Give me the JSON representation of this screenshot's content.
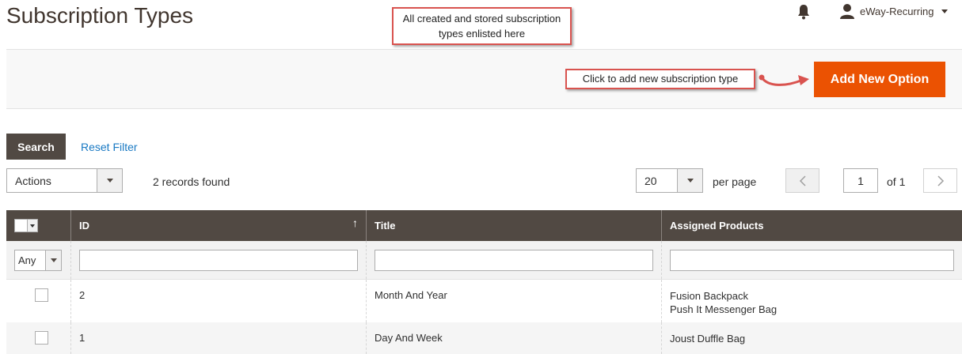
{
  "header": {
    "title": "Subscription Types",
    "user_name": "eWay-Recurring",
    "icons": {
      "notifications": "bell-icon",
      "user": "user-icon"
    }
  },
  "callouts": {
    "top": "All  created and stored subscription types enlisted here",
    "add": "Click to add new subscription type"
  },
  "toolbar": {
    "add_label": "Add New Option",
    "accent": "#eb5202"
  },
  "filters": {
    "search_label": "Search",
    "reset_label": "Reset Filter"
  },
  "grid_controls": {
    "actions_label": "Actions",
    "records_found": "2 records found",
    "per_page_value": "20",
    "per_page_label": "per page",
    "current_page": "1",
    "of_pages": "of 1"
  },
  "table": {
    "columns": [
      "ID",
      "Title",
      "Assigned Products"
    ],
    "any_option": "Any",
    "sort_arrow": "↑",
    "rows": [
      {
        "id": "2",
        "title": "Month And Year",
        "products": [
          "Fusion Backpack",
          "Push It Messenger Bag"
        ]
      },
      {
        "id": "1",
        "title": "Day And Week",
        "products": [
          "Joust Duffle Bag"
        ]
      }
    ]
  },
  "colors": {
    "header_bg": "#514943",
    "link": "#1979c3",
    "callout_border": "#d9534f"
  }
}
